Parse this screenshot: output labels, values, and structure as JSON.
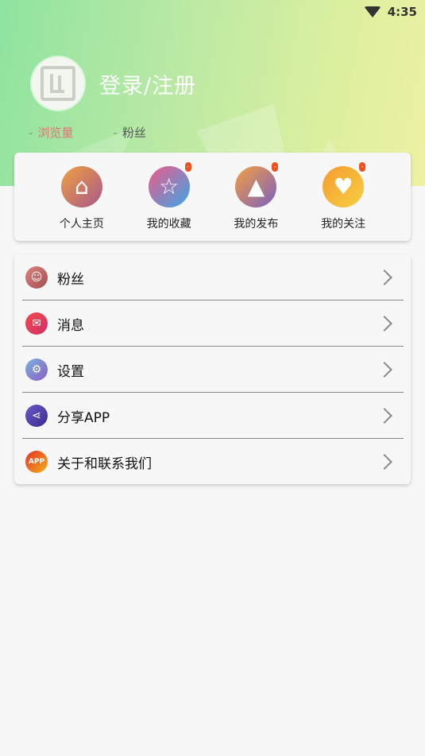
{
  "status_bar": {
    "time": "4:35"
  },
  "profile": {
    "login_label": "登录/注册",
    "stats": [
      {
        "value": "-",
        "label": "浏览量"
      },
      {
        "value": "-",
        "label": "粉丝"
      }
    ]
  },
  "quick_actions": [
    {
      "label": "个人主页",
      "icon": "home-icon",
      "badge": ""
    },
    {
      "label": "我的收藏",
      "icon": "star-icon",
      "badge": "-"
    },
    {
      "label": "我的发布",
      "icon": "compass-icon",
      "badge": "-"
    },
    {
      "label": "我的关注",
      "icon": "heart-icon",
      "badge": "-"
    }
  ],
  "menu": [
    {
      "label": "粉丝",
      "icon": "fans-icon"
    },
    {
      "label": "消息",
      "icon": "message-icon"
    },
    {
      "label": "设置",
      "icon": "settings-icon"
    },
    {
      "label": "分享APP",
      "icon": "share-icon"
    },
    {
      "label": "关于和联系我们",
      "icon": "about-icon",
      "icon_text": "APP"
    }
  ]
}
